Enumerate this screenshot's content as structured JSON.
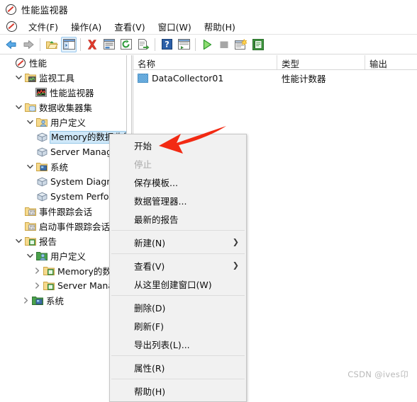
{
  "window": {
    "title": "性能监视器",
    "app_icon": "mmc-console-icon"
  },
  "menubar": {
    "icon": "mmc-console-icon",
    "items": [
      {
        "label": "文件(F)"
      },
      {
        "label": "操作(A)"
      },
      {
        "label": "查看(V)"
      },
      {
        "label": "窗口(W)"
      },
      {
        "label": "帮助(H)"
      }
    ]
  },
  "toolbar": {
    "buttons": [
      {
        "name": "back-icon",
        "checked": false
      },
      {
        "name": "forward-icon",
        "checked": false
      },
      {
        "name": "up-folder-icon",
        "checked": false
      },
      {
        "name": "show-console-tree-icon",
        "checked": true
      },
      {
        "name": "delete-icon",
        "checked": false
      },
      {
        "name": "properties-icon",
        "checked": false
      },
      {
        "name": "refresh-icon",
        "checked": false
      },
      {
        "name": "export-list-icon",
        "checked": false
      },
      {
        "name": "help-icon",
        "checked": false
      },
      {
        "name": "new-window-icon",
        "checked": false
      },
      {
        "name": "start-icon",
        "checked": false
      },
      {
        "name": "stop-icon",
        "checked": false
      },
      {
        "name": "new-data-collector-set-icon",
        "checked": false
      },
      {
        "name": "report-icon",
        "checked": false
      }
    ]
  },
  "tree": {
    "nodes": [
      {
        "label": "性能",
        "indent": 0,
        "twisty": "none",
        "icon": "mmc-console-icon",
        "selected": false
      },
      {
        "label": "监视工具",
        "indent": 1,
        "twisty": "expanded",
        "icon": "folder-monitor-icon",
        "selected": false
      },
      {
        "label": "性能监视器",
        "indent": 2,
        "twisty": "none",
        "icon": "perfmon-chart-icon",
        "selected": false
      },
      {
        "label": "数据收集器集",
        "indent": 1,
        "twisty": "expanded",
        "icon": "folder-data-icon",
        "selected": false
      },
      {
        "label": "用户定义",
        "indent": 2,
        "twisty": "expanded",
        "icon": "folder-user-icon",
        "selected": false
      },
      {
        "label": "Memory的数据收集器集",
        "indent": 3,
        "twisty": "none",
        "icon": "collector-set-icon",
        "selected": true
      },
      {
        "label": "Server Manager Performance Monitor",
        "indent": 3,
        "twisty": "none",
        "icon": "collector-set-icon",
        "selected": false
      },
      {
        "label": "系统",
        "indent": 2,
        "twisty": "expanded",
        "icon": "folder-system-icon",
        "selected": false
      },
      {
        "label": "System Diagnostics",
        "indent": 3,
        "twisty": "none",
        "icon": "collector-set-icon",
        "selected": false
      },
      {
        "label": "System Performance",
        "indent": 3,
        "twisty": "none",
        "icon": "collector-set-icon",
        "selected": false
      },
      {
        "label": "事件跟踪会话",
        "indent": 2,
        "twisty": "none",
        "icon": "folder-trace-icon",
        "selected": false
      },
      {
        "label": "启动事件跟踪会话",
        "indent": 2,
        "twisty": "none",
        "icon": "folder-trace-icon",
        "selected": false
      },
      {
        "label": "报告",
        "indent": 1,
        "twisty": "expanded",
        "icon": "folder-report-icon",
        "selected": false
      },
      {
        "label": "用户定义",
        "indent": 2,
        "twisty": "expanded",
        "icon": "folder-user-report-icon",
        "selected": false
      },
      {
        "label": "Memory的数据收集器集",
        "indent": 3,
        "twisty": "collapsed",
        "icon": "folder-report-icon",
        "selected": false
      },
      {
        "label": "Server Manager Performance Monitor",
        "indent": 3,
        "twisty": "collapsed",
        "icon": "folder-report-icon",
        "selected": false
      },
      {
        "label": "系统",
        "indent": 2,
        "twisty": "collapsed",
        "icon": "folder-sysreport-icon",
        "selected": false
      }
    ]
  },
  "list": {
    "columns": [
      {
        "label": "名称"
      },
      {
        "label": "类型"
      },
      {
        "label": "输出"
      }
    ],
    "rows": [
      {
        "name": "DataCollector01",
        "type": "性能计数器",
        "output": ""
      }
    ]
  },
  "context_menu": {
    "items": [
      {
        "label": "开始",
        "type": "item",
        "disabled": false
      },
      {
        "label": "停止",
        "type": "item",
        "disabled": true
      },
      {
        "label": "保存模板...",
        "type": "item",
        "disabled": false
      },
      {
        "label": "数据管理器...",
        "type": "item",
        "disabled": false
      },
      {
        "label": "最新的报告",
        "type": "item",
        "disabled": false
      },
      {
        "label": "",
        "type": "separator",
        "disabled": false
      },
      {
        "label": "新建(N)",
        "type": "submenu",
        "disabled": false
      },
      {
        "label": "",
        "type": "separator",
        "disabled": false
      },
      {
        "label": "查看(V)",
        "type": "submenu",
        "disabled": false
      },
      {
        "label": "从这里创建窗口(W)",
        "type": "item",
        "disabled": false
      },
      {
        "label": "",
        "type": "separator",
        "disabled": false
      },
      {
        "label": "删除(D)",
        "type": "item",
        "disabled": false
      },
      {
        "label": "刷新(F)",
        "type": "item",
        "disabled": false
      },
      {
        "label": "导出列表(L)...",
        "type": "item",
        "disabled": false
      },
      {
        "label": "",
        "type": "separator",
        "disabled": false
      },
      {
        "label": "属性(R)",
        "type": "item",
        "disabled": false
      },
      {
        "label": "",
        "type": "separator",
        "disabled": false
      },
      {
        "label": "帮助(H)",
        "type": "item",
        "disabled": false
      }
    ]
  },
  "annotation": {
    "arrow_color": "#f22a13",
    "points_to": "开始"
  },
  "watermark": {
    "text": "CSDN @ives卬"
  }
}
